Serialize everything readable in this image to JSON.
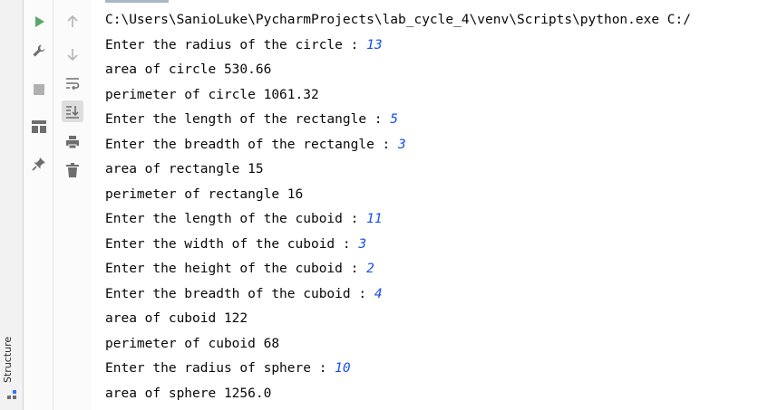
{
  "structure_panel": {
    "label": "Structure"
  },
  "run_toolbar": {
    "buttons": [
      {
        "name": "rerun-button",
        "icon": "play-icon",
        "color": "#59a869"
      },
      {
        "name": "edit-configuration-button",
        "icon": "wrench-icon",
        "color": "#6e6e6e"
      },
      {
        "name": "stop-button",
        "icon": "stop-icon",
        "color": "#b0b0b0"
      },
      {
        "name": "layout-button",
        "icon": "layout-icon",
        "color": "#6e6e6e"
      },
      {
        "name": "pin-tab-button",
        "icon": "pin-icon",
        "color": "#6e6e6e"
      }
    ]
  },
  "console_toolbar": {
    "buttons": [
      {
        "name": "scroll-up-button",
        "icon": "arrow-up-icon"
      },
      {
        "name": "scroll-down-button",
        "icon": "arrow-down-icon"
      },
      {
        "name": "soft-wrap-button",
        "icon": "soft-wrap-icon"
      },
      {
        "name": "scroll-to-end-button",
        "icon": "scroll-to-end-icon",
        "active": true
      },
      {
        "name": "print-button",
        "icon": "print-icon"
      },
      {
        "name": "clear-all-button",
        "icon": "trash-icon"
      }
    ]
  },
  "console": {
    "input_color": "#1750eb",
    "text_color": "#080808",
    "lines": [
      {
        "text": "C:\\Users\\SanioLuke\\PycharmProjects\\lab_cycle_4\\venv\\Scripts\\python.exe C:/",
        "input": ""
      },
      {
        "text": "Enter the radius of the circle : ",
        "input": "13"
      },
      {
        "text": "area of circle 530.66",
        "input": ""
      },
      {
        "text": "perimeter of circle 1061.32",
        "input": ""
      },
      {
        "text": "Enter the length of the rectangle : ",
        "input": "5"
      },
      {
        "text": "Enter the breadth of the rectangle : ",
        "input": "3"
      },
      {
        "text": "area of rectangle 15",
        "input": ""
      },
      {
        "text": "perimeter of rectangle 16",
        "input": ""
      },
      {
        "text": "Enter the length of the cuboid : ",
        "input": "11"
      },
      {
        "text": "Enter the width of the cuboid : ",
        "input": "3"
      },
      {
        "text": "Enter the height of the cuboid : ",
        "input": "2"
      },
      {
        "text": "Enter the breadth of the cuboid : ",
        "input": "4"
      },
      {
        "text": "area of cuboid 122",
        "input": ""
      },
      {
        "text": "perimeter of cuboid 68",
        "input": ""
      },
      {
        "text": "Enter the radius of sphere : ",
        "input": "10"
      },
      {
        "text": "area of sphere 1256.0",
        "input": ""
      }
    ]
  }
}
